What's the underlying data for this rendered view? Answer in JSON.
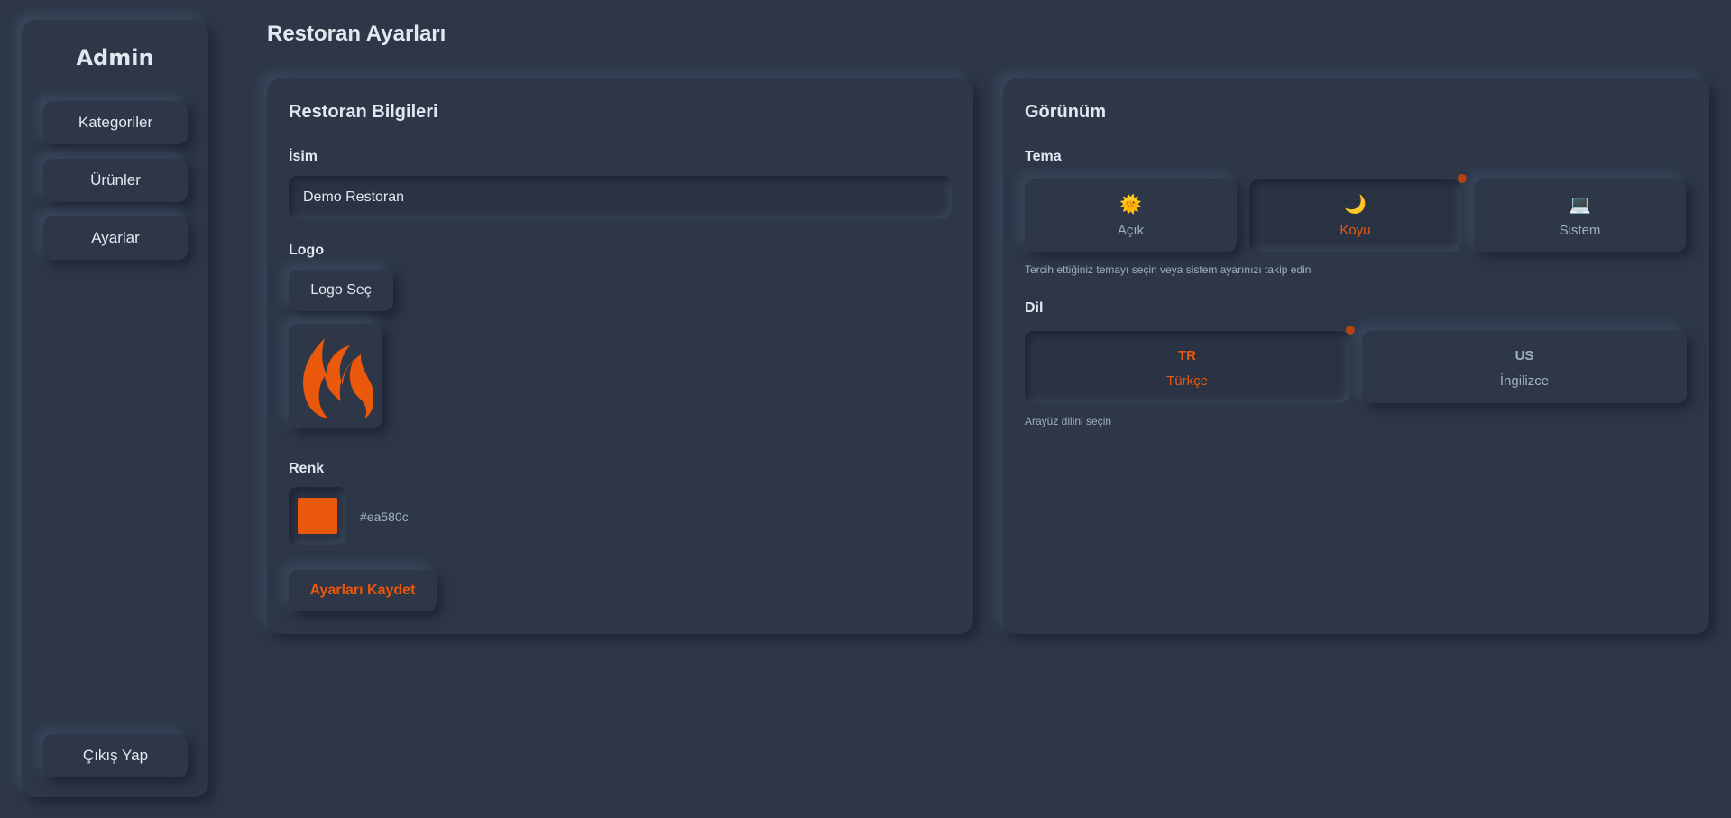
{
  "colors": {
    "background": "#2d3748",
    "accent": "#ea580c",
    "text": "#e2e8f0",
    "muted": "#a0aec0"
  },
  "sidebar": {
    "title": "Admin",
    "items": [
      {
        "label": "Kategoriler"
      },
      {
        "label": "Ürünler"
      },
      {
        "label": "Ayarlar"
      }
    ],
    "logout_label": "Çıkış Yap"
  },
  "page": {
    "title": "Restoran Ayarları"
  },
  "info_card": {
    "title": "Restoran Bilgileri",
    "name_label": "İsim",
    "name_value": "Demo Restoran",
    "logo_label": "Logo",
    "logo_button": "Logo Seç",
    "logo_icon": "flame-icon",
    "color_label": "Renk",
    "color_value": "#ea580c",
    "save_button": "Ayarları Kaydet"
  },
  "appearance_card": {
    "title": "Görünüm",
    "theme_label": "Tema",
    "themes": [
      {
        "label": "Açık",
        "icon": "sun-icon",
        "glyph": "🌞"
      },
      {
        "label": "Koyu",
        "icon": "moon-icon",
        "glyph": "🌙",
        "selected": true
      },
      {
        "label": "Sistem",
        "icon": "laptop-icon",
        "glyph": "💻"
      }
    ],
    "theme_hint": "Tercih ettiğiniz temayı seçin veya sistem ayarınızı takip edin",
    "language_label": "Dil",
    "languages": [
      {
        "code": "TR",
        "label": "Türkçe",
        "selected": true
      },
      {
        "code": "US",
        "label": "İngilizce"
      }
    ],
    "language_hint": "Arayüz dilini seçin"
  }
}
